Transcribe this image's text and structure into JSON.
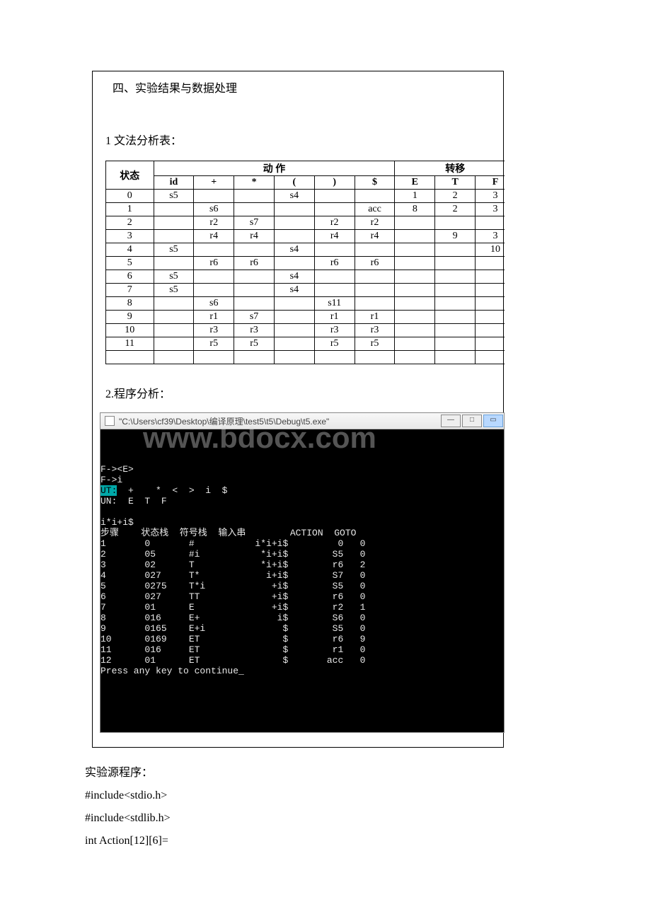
{
  "headings": {
    "section": "四、实验结果与数据处理",
    "sub1": "1 文法分析表：",
    "sub2": "2.程序分析：",
    "source_title": "实验源程序：",
    "src1": "#include<stdio.h>",
    "src2": "#include<stdlib.h>",
    "src3": "int Action[12][6]="
  },
  "table": {
    "header_state": "状态",
    "header_action": "动        作",
    "header_goto": "转移",
    "cols_action": [
      "id",
      "+",
      "*",
      "(",
      ")",
      "$"
    ],
    "cols_goto": [
      "E",
      "T",
      "F"
    ],
    "rows": [
      {
        "state": "0",
        "cells": [
          "s5",
          "",
          "",
          "s4",
          "",
          ""
        ],
        "goto": [
          "1",
          "2",
          "3"
        ]
      },
      {
        "state": "1",
        "cells": [
          "",
          "s6",
          "",
          "",
          "",
          "acc"
        ],
        "goto": [
          "8",
          "2",
          "3"
        ]
      },
      {
        "state": "2",
        "cells": [
          "",
          "r2",
          "s7",
          "",
          "r2",
          "r2"
        ],
        "goto": [
          "",
          "",
          ""
        ]
      },
      {
        "state": "3",
        "cells": [
          "",
          "r4",
          "r4",
          "",
          "r4",
          "r4"
        ],
        "goto": [
          "",
          "9",
          "3"
        ]
      },
      {
        "state": "4",
        "cells": [
          "s5",
          "",
          "",
          "s4",
          "",
          ""
        ],
        "goto": [
          "",
          "",
          "10"
        ]
      },
      {
        "state": "5",
        "cells": [
          "",
          "r6",
          "r6",
          "",
          "r6",
          "r6"
        ],
        "goto": [
          "",
          "",
          ""
        ]
      },
      {
        "state": "6",
        "cells": [
          "s5",
          "",
          "",
          "s4",
          "",
          ""
        ],
        "goto": [
          "",
          "",
          ""
        ]
      },
      {
        "state": "7",
        "cells": [
          "s5",
          "",
          "",
          "s4",
          "",
          ""
        ],
        "goto": [
          "",
          "",
          ""
        ]
      },
      {
        "state": "8",
        "cells": [
          "",
          "s6",
          "",
          "",
          "s11",
          ""
        ],
        "goto": [
          "",
          "",
          ""
        ]
      },
      {
        "state": "9",
        "cells": [
          "",
          "r1",
          "s7",
          "",
          "r1",
          "r1"
        ],
        "goto": [
          "",
          "",
          ""
        ]
      },
      {
        "state": "10",
        "cells": [
          "",
          "r3",
          "r3",
          "",
          "r3",
          "r3"
        ],
        "goto": [
          "",
          "",
          ""
        ]
      },
      {
        "state": "11",
        "cells": [
          "",
          "r5",
          "r5",
          "",
          "r5",
          "r5"
        ],
        "goto": [
          "",
          "",
          ""
        ]
      }
    ]
  },
  "console": {
    "title": "\"C:\\Users\\cf39\\Desktop\\编译原理\\test5\\t5\\Debug\\t5.exe\"",
    "watermark": "www.bdocx.com",
    "pre_lines": [
      "F-><E>",
      "",
      "F->i",
      "",
      "",
      ""
    ],
    "ut_line_prefix": "UT:",
    "ut_line_rest": "  +    *  <  >  i  $",
    "un_line": "UN:  E  T  F",
    "blank": "",
    "input_line": "i*i+i$",
    "header": "步骤    状态栈  符号栈  输入串        ACTION  GOTO",
    "steps": [
      {
        "n": "1",
        "st": "0",
        "sy": "#",
        "in": "i*i+i$",
        "ac": "0",
        "go": "0"
      },
      {
        "n": "2",
        "st": "05",
        "sy": "#i",
        "in": "*i+i$",
        "ac": "S5",
        "go": "0"
      },
      {
        "n": "3",
        "st": "02",
        "sy": "T",
        "in": "*i+i$",
        "ac": "r6",
        "go": "2"
      },
      {
        "n": "4",
        "st": "027",
        "sy": "T*",
        "in": "i+i$",
        "ac": "S7",
        "go": "0"
      },
      {
        "n": "5",
        "st": "0275",
        "sy": "T*i",
        "in": "+i$",
        "ac": "S5",
        "go": "0"
      },
      {
        "n": "6",
        "st": "027",
        "sy": "TT",
        "in": "+i$",
        "ac": "r6",
        "go": "0"
      },
      {
        "n": "7",
        "st": "01",
        "sy": "E",
        "in": "+i$",
        "ac": "r2",
        "go": "1"
      },
      {
        "n": "8",
        "st": "016",
        "sy": "E+",
        "in": "i$",
        "ac": "S6",
        "go": "0"
      },
      {
        "n": "9",
        "st": "0165",
        "sy": "E+i",
        "in": "$",
        "ac": "S5",
        "go": "0"
      },
      {
        "n": "10",
        "st": "0169",
        "sy": "ET",
        "in": "$",
        "ac": "r6",
        "go": "9"
      },
      {
        "n": "11",
        "st": "016",
        "sy": "ET",
        "in": "$",
        "ac": "r1",
        "go": "0"
      },
      {
        "n": "12",
        "st": "01",
        "sy": "ET",
        "in": "$",
        "ac": "acc",
        "go": "0"
      }
    ],
    "press": "Press any key to continue_"
  },
  "icons": {
    "minimize": "—",
    "maximize": "□",
    "close": "▭"
  }
}
